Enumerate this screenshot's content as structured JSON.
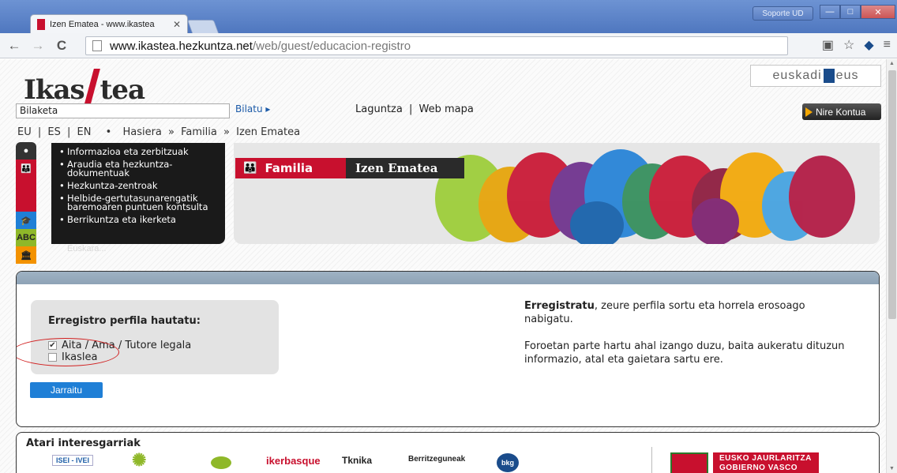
{
  "browser": {
    "tab_title": "Izen Ematea - www.ikastea",
    "tab_close": "✕",
    "user_label": "Soporte UD",
    "win_min": "—",
    "win_max": "□",
    "win_close": "✕",
    "back": "←",
    "forward": "→",
    "reload": "C",
    "url_host": "www.ikastea.hezkuntza.net",
    "url_path": "/web/guest/educacion-registro",
    "tb_icons": [
      "translate-icon",
      "star-icon",
      "extension-icon",
      "menu-icon"
    ],
    "tb_glyphs": [
      "▣",
      "☆",
      "◆",
      "≡"
    ]
  },
  "header": {
    "logo_left": "Ikas",
    "logo_right": "tea",
    "euskadi_left": "euskadi",
    "euskadi_right": "eus",
    "search_value": "Bilaketa",
    "search_button": "Bilatu ▸",
    "help_link": "Laguntza",
    "sitemap_link": "Web mapa",
    "separator": "|",
    "account_button": "Nire Kontua"
  },
  "breadcrumb": {
    "langs": [
      "EU",
      "ES",
      "EN"
    ],
    "sep": "|",
    "bullet": "•",
    "home": "Hasiera",
    "arrow": "»",
    "family": "Familia",
    "current": "Izen Ematea"
  },
  "menu": {
    "items": [
      "Informazioa eta zerbitzuak",
      "Araudia eta hezkuntza-dokumentuak",
      "Hezkuntza-zentroak",
      "Helbide-gertutasunarengatik baremoaren puntuen kontsulta",
      "Berrikuntza eta ikerketa"
    ],
    "faded": "Euskara..."
  },
  "banner": {
    "family_icon": "👪",
    "family_label": "Familia",
    "section_label": "Izen Ematea"
  },
  "register": {
    "profile_title": "Erregistro perfila hautatu:",
    "option_parent": "Aita / Ama / Tutore legala",
    "option_student": "Ikaslea",
    "parent_checked": "✔",
    "continue_button": "Jarraitu",
    "info_bold": "Erregistratu",
    "info_rest": ", zeure perfila sortu eta horrela erosoago nabigatu.",
    "info_2": "Foroetan parte hartu ahal izango duzu, baita aukeratu dituzun informazio, atal eta gaietara sartu ere."
  },
  "partners": {
    "title": "Atari interesgarriak",
    "logos": [
      "ISEI - IVEI",
      "",
      "",
      "ikerbasque",
      "Tknika",
      "Berritzeguneak",
      "bkg"
    ],
    "gov_line1": "EUSKO JAURLARITZA",
    "gov_line2": "GOBIERNO VASCO"
  },
  "colors": {
    "brand_red": "#c8102e",
    "link_blue": "#1b5aa8",
    "button_blue": "#1f7fd6",
    "menu_dark": "#1a1a1a"
  }
}
